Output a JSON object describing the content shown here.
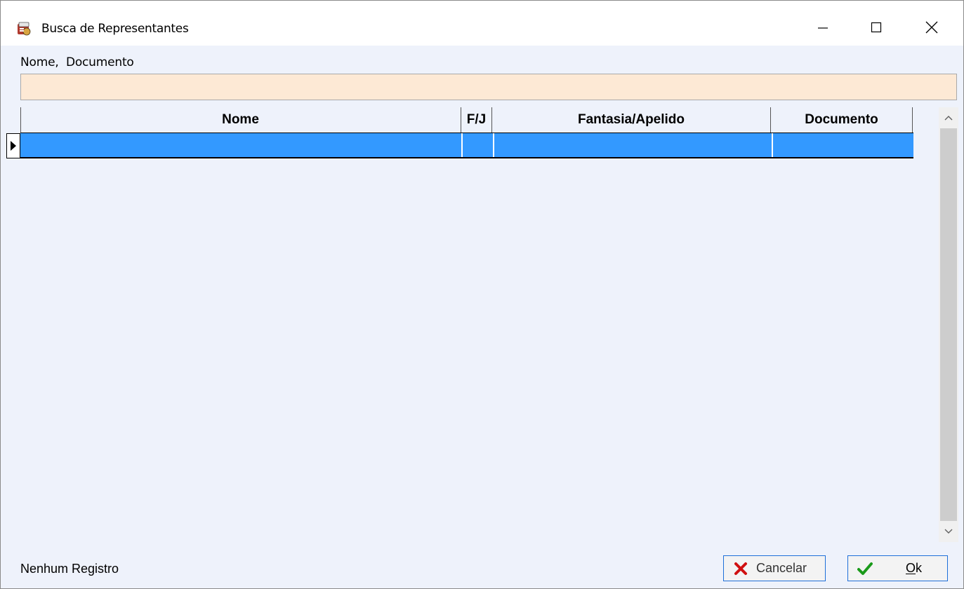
{
  "window": {
    "title": "Busca de Representantes",
    "icon": "app-icon"
  },
  "search": {
    "label": "Nome,  Documento",
    "value": "",
    "placeholder": ""
  },
  "grid": {
    "columns": [
      "Nome",
      "F/J",
      "Fantasia/Apelido",
      "Documento"
    ],
    "rows": [
      [
        "",
        "",
        "",
        ""
      ]
    ],
    "selected_row_color": "#3399ff"
  },
  "status": {
    "text": "Nenhum Registro"
  },
  "buttons": {
    "cancel_label": "Cancelar",
    "ok_label_first": "O",
    "ok_label_rest": "k"
  },
  "colors": {
    "input_bg": "#fde9d5",
    "window_bg": "#eef2fb",
    "cancel_icon": "#d01010",
    "ok_icon": "#1a9a1a"
  }
}
